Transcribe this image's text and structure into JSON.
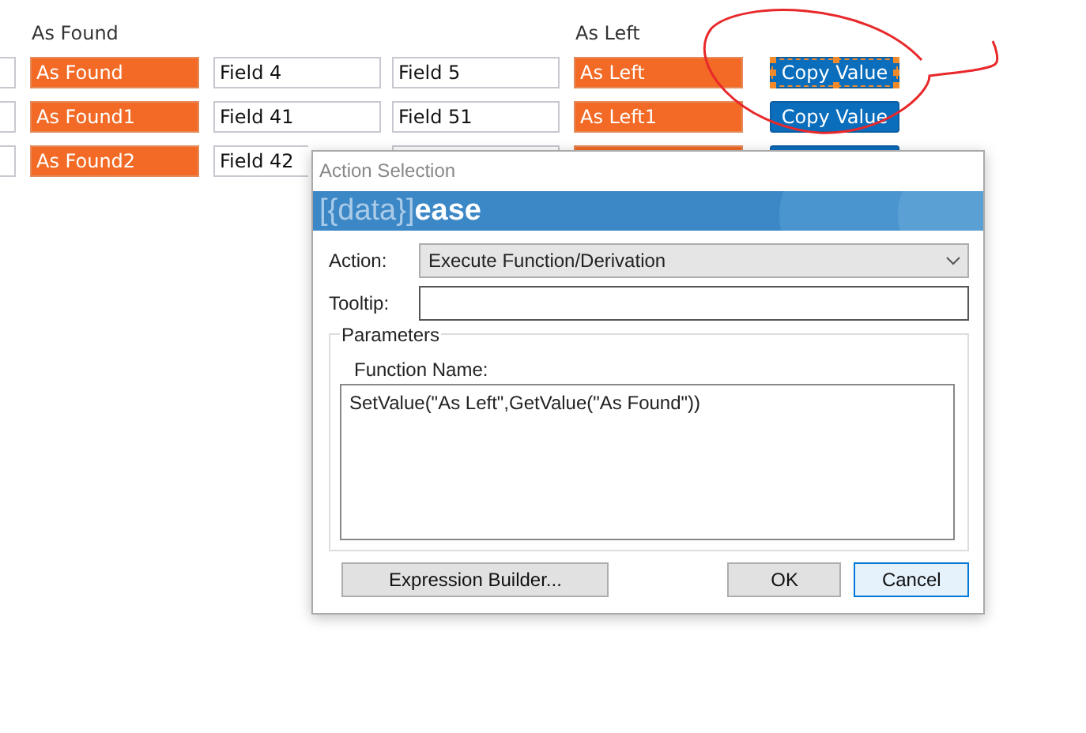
{
  "headers": {
    "as_found": "As Found",
    "as_left": "As Left"
  },
  "rows": [
    {
      "cells": [
        {
          "kind": "field"
        },
        {
          "kind": "highlighted",
          "value": "As Found"
        },
        {
          "kind": "field",
          "value": "Field 4"
        },
        {
          "kind": "field",
          "value": "Field 5"
        },
        {
          "kind": "highlighted",
          "value": "As Left"
        }
      ],
      "button": {
        "label": "Copy Value",
        "selected": true
      }
    },
    {
      "cells": [
        {
          "kind": "field"
        },
        {
          "kind": "highlighted",
          "value": "As Found1"
        },
        {
          "kind": "field",
          "value": "Field 41"
        },
        {
          "kind": "field",
          "value": "Field 51"
        },
        {
          "kind": "highlighted",
          "value": "As Left1"
        }
      ],
      "button": {
        "label": "Copy Value",
        "selected": false
      }
    },
    {
      "cells": [
        {
          "kind": "field"
        },
        {
          "kind": "highlighted",
          "value": "As Found2"
        },
        {
          "kind": "field",
          "value": "Field 42"
        },
        {
          "kind": "field"
        },
        {
          "kind": "highlighted"
        }
      ],
      "button": {
        "selected": false
      }
    }
  ],
  "dialog": {
    "title": "Action Selection",
    "logo": {
      "bracket_text": "[{data}]",
      "bold_text": "ease"
    },
    "action": {
      "label": "Action:",
      "value": "Execute Function/Derivation"
    },
    "tooltip": {
      "label": "Tooltip:"
    },
    "parameters": {
      "title": "Parameters",
      "function_label": "Function Name:",
      "function_value": "SetValue(\"As Left\",GetValue(\"As Found\"))"
    },
    "buttons": [
      {
        "label": "Expression Builder...",
        "kind": "secondary"
      },
      {
        "label": "OK",
        "kind": "normal"
      },
      {
        "label": "Cancel",
        "kind": "default"
      }
    ]
  }
}
